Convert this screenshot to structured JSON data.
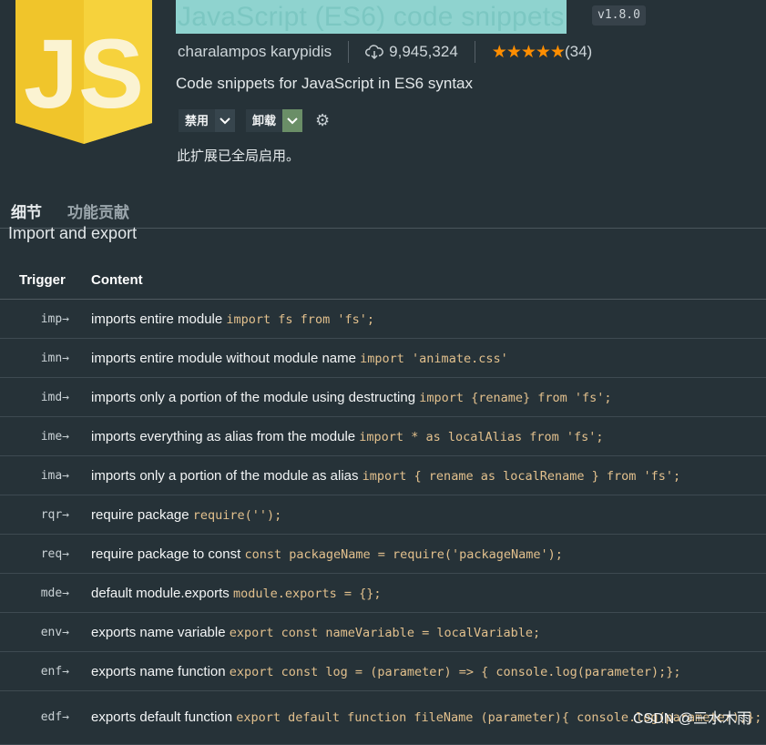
{
  "extension": {
    "title": "JavaScript (ES6) code snippets",
    "version": "v1.8.0",
    "publisher": "charalampos karypidis",
    "installs": "9,945,324",
    "rating_stars": "★★★★★",
    "rating_count": "(34)",
    "description": "Code snippets for JavaScript in ES6 syntax",
    "disable_label": "禁用",
    "uninstall_label": "卸载",
    "enabled_message": "此扩展已全局启用。",
    "logo_text": "JS"
  },
  "tabs": [
    "细节",
    "功能贡献"
  ],
  "section_heading": "Import and export",
  "table": {
    "headers": [
      "Trigger",
      "Content"
    ],
    "rows": [
      {
        "trigger": "imp→",
        "desc": "imports entire module ",
        "code": "import fs from 'fs';"
      },
      {
        "trigger": "imn→",
        "desc": "imports entire module without module name ",
        "code": "import 'animate.css'"
      },
      {
        "trigger": "imd→",
        "desc": "imports only a portion of the module using destructing ",
        "code": "import {rename} from 'fs';"
      },
      {
        "trigger": "ime→",
        "desc": "imports everything as alias from the module ",
        "code": "import * as localAlias from 'fs';"
      },
      {
        "trigger": "ima→",
        "desc": "imports only a portion of the module as alias ",
        "code": "import { rename as localRename } from 'fs';"
      },
      {
        "trigger": "rqr→",
        "desc": "require package ",
        "code": "require('');"
      },
      {
        "trigger": "req→",
        "desc": "require package to const ",
        "code": "const packageName = require('packageName');"
      },
      {
        "trigger": "mde→",
        "desc": "default module.exports ",
        "code": "module.exports = {};"
      },
      {
        "trigger": "env→",
        "desc": "exports name variable ",
        "code": "export const nameVariable = localVariable;"
      },
      {
        "trigger": "enf→",
        "desc": "exports name function ",
        "code": "export const log = (parameter) => { console.log(parameter);};"
      },
      {
        "trigger": "edf→",
        "desc": "exports default function ",
        "code": "export default function fileName (parameter){ console.log(parameter);};"
      }
    ]
  },
  "watermark": "CSDN @三水木雨",
  "colors": {
    "background": "#263238",
    "accent_stars": "#ff8e00",
    "code": "#e2c08d",
    "logo": "#f5c82a"
  }
}
